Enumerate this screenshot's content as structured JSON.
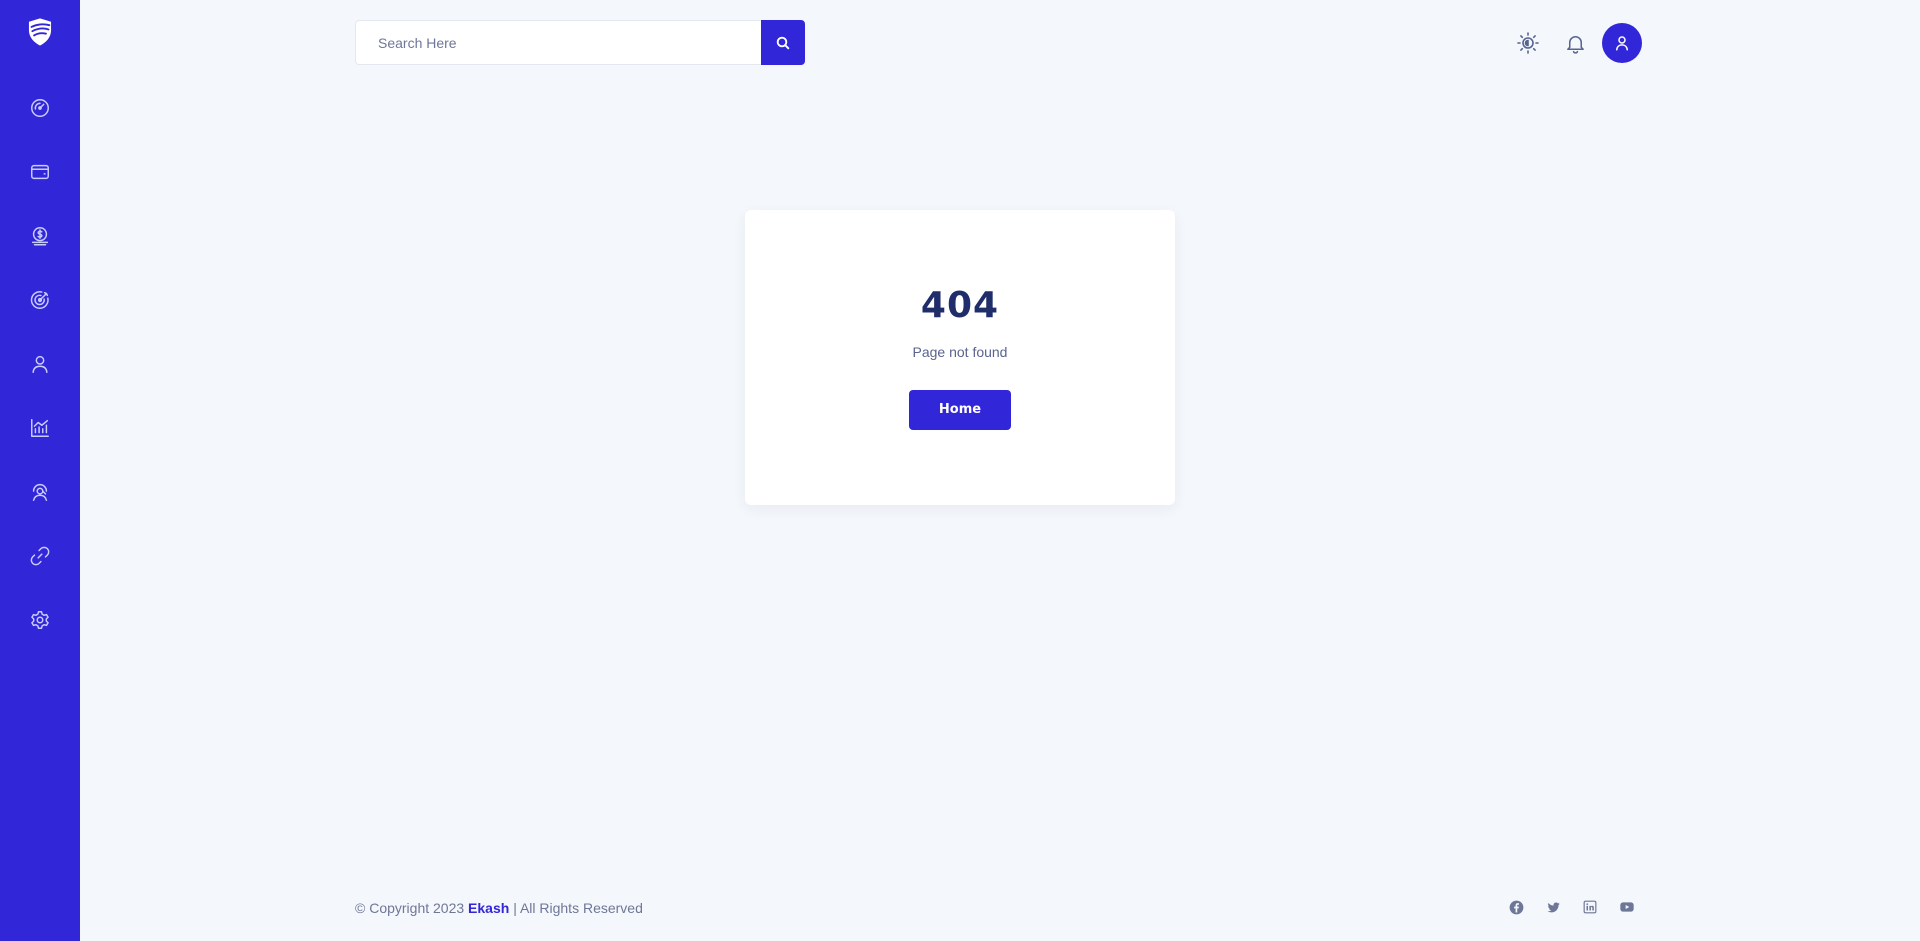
{
  "sidebar": {
    "logo_icon": "shield-logo-icon",
    "items": [
      {
        "icon": "dashboard-icon"
      },
      {
        "icon": "wallet-icon"
      },
      {
        "icon": "money-bag-icon"
      },
      {
        "icon": "target-icon"
      },
      {
        "icon": "user-icon"
      },
      {
        "icon": "analytics-icon"
      },
      {
        "icon": "support-icon"
      },
      {
        "icon": "link-icon"
      },
      {
        "icon": "settings-icon"
      }
    ]
  },
  "search": {
    "placeholder": "Search Here",
    "value": ""
  },
  "error": {
    "code": "404",
    "message": "Page not found",
    "button_label": "Home"
  },
  "footer": {
    "copyright_prefix": "© Copyright 2023",
    "brand": "Ekash",
    "copyright_suffix": "| All Rights Reserved",
    "socials": [
      "facebook-icon",
      "twitter-icon",
      "linkedin-icon",
      "youtube-icon"
    ]
  },
  "colors": {
    "primary": "#3226d9",
    "background": "#f4f7fb",
    "card": "#ffffff",
    "heading": "#1f2d6a",
    "muted": "#59648f",
    "icon": "#6e7797"
  }
}
